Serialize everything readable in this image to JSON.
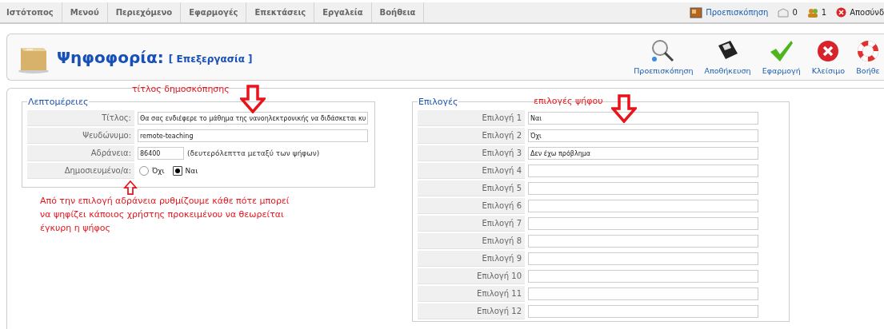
{
  "menu": [
    {
      "label": "Ιστότοπος"
    },
    {
      "label": "Μενού"
    },
    {
      "label": "Περιεχόμενο"
    },
    {
      "label": "Εφαρμογές"
    },
    {
      "label": "Επεκτάσεις"
    },
    {
      "label": "Εργαλεία"
    },
    {
      "label": "Βοήθεια"
    }
  ],
  "status": {
    "preview": "Προεπισκόπηση",
    "messages": "0",
    "users": "1",
    "logout": "Αποσύνδ"
  },
  "header": {
    "title": "Ψηφοφορία:",
    "subtitle": "[ Επεξεργασία ]"
  },
  "toolbar": [
    {
      "kind": "preview",
      "label": "Προεπισκόπηση"
    },
    {
      "kind": "save",
      "label": "Αποθήκευση"
    },
    {
      "kind": "apply",
      "label": "Εφαρμογή"
    },
    {
      "kind": "close",
      "label": "Κλείσιμο"
    },
    {
      "kind": "help",
      "label": "Βοήθε"
    }
  ],
  "details": {
    "legend": "Λεπτομέρειες",
    "title_label": "Τίτλος:",
    "title_value": "Θα σας ενδιέφερε το μάθημα της νανοηλεκτρονικής να διδάσκεται κυ",
    "alias_label": "Ψευδώνυμο:",
    "alias_value": "remote-teaching",
    "lag_label": "Αδράνεια:",
    "lag_value": "86400",
    "lag_hint": "(δευτερόλεπττα μεταξύ των ψήφων)",
    "published_label": "Δημοσιευμένο/α:",
    "published_options": [
      {
        "label": "Όχι",
        "selected": false
      },
      {
        "label": "Ναι",
        "selected": true
      }
    ]
  },
  "options": {
    "legend": "Επιλογές",
    "items": [
      {
        "label": "Επιλογή 1",
        "value": "Ναι"
      },
      {
        "label": "Επιλογή 2",
        "value": "Όχι"
      },
      {
        "label": "Επιλογή 3",
        "value": "Δεν έχω πρόβλημα"
      },
      {
        "label": "Επιλογή 4"
      },
      {
        "label": "Επιλογή 5"
      },
      {
        "label": "Επιλογή 6"
      },
      {
        "label": "Επιλογή 7"
      },
      {
        "label": "Επιλογή 8"
      },
      {
        "label": "Επιλογή 9"
      },
      {
        "label": "Επιλογή 10"
      },
      {
        "label": "Επιλογή 11"
      },
      {
        "label": "Επιλογή 12"
      }
    ]
  },
  "annotations": [
    {
      "kind": "down",
      "text": "τίτλος δημοσκόπησης"
    },
    {
      "kind": "down",
      "text": "επιλογές ψήφου"
    },
    {
      "kind": "up",
      "text": "Από την επιλογή αδράνεια ρυθμίζουμε κάθε πότε μπορεί να ψηφίζει κάποιος χρήστης προκειμένου να θεωρείται έγκυρη η ψήφος"
    }
  ]
}
